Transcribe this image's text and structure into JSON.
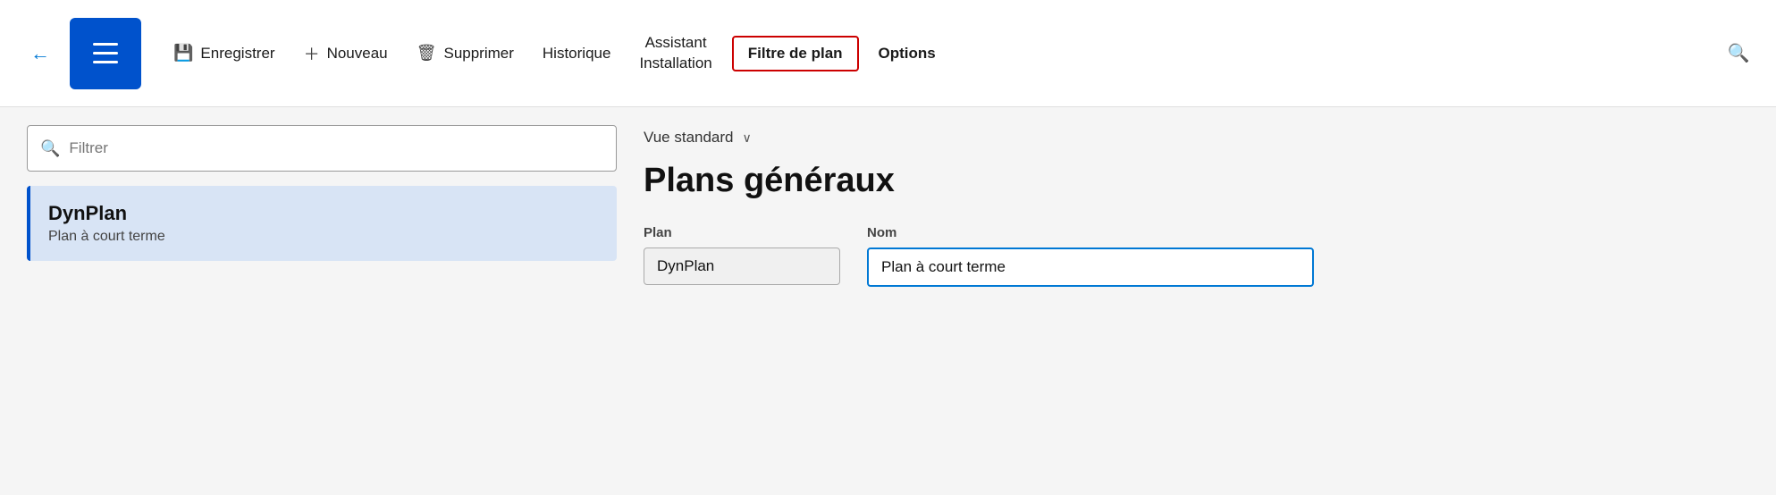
{
  "toolbar": {
    "back_label": "←",
    "menu_button_label": "Menu",
    "save_label": "Enregistrer",
    "new_label": "Nouveau",
    "delete_label": "Supprimer",
    "history_label": "Historique",
    "assistant_line1": "Assistant",
    "assistant_line2": "Installation",
    "filter_plan_label": "Filtre de plan",
    "options_label": "Options",
    "search_icon": "🔍"
  },
  "left_panel": {
    "filter_placeholder": "Filtrer",
    "list_item": {
      "title": "DynPlan",
      "subtitle": "Plan à court terme"
    }
  },
  "right_panel": {
    "view_label": "Vue standard",
    "chevron": "∨",
    "page_title": "Plans généraux",
    "form": {
      "plan_label": "Plan",
      "plan_value": "DynPlan",
      "nom_label": "Nom",
      "nom_value": "Plan à court terme"
    }
  }
}
